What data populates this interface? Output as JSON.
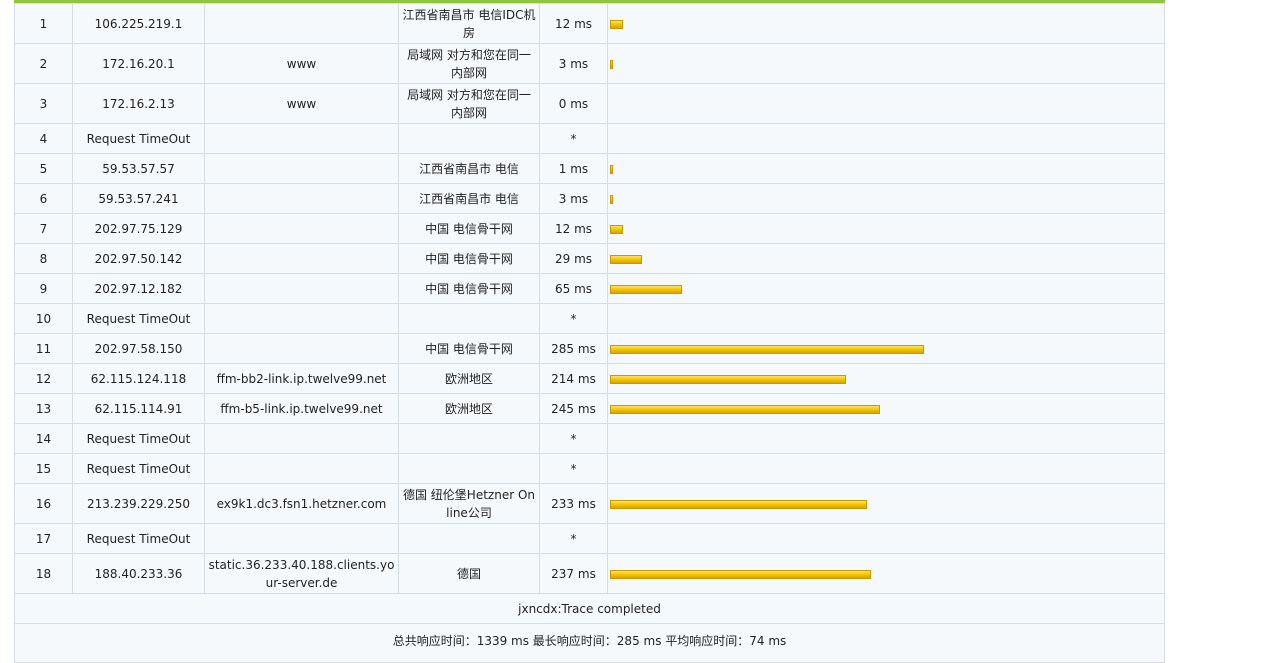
{
  "accent_color": "#8ec63f",
  "bar_color": "#f6c800",
  "max_bar_ms": 285,
  "hops": [
    {
      "hop": "1",
      "ip": "106.225.219.1",
      "host": "",
      "location": "江西省南昌市 电信IDC机房",
      "time": "12 ms",
      "ms": 12
    },
    {
      "hop": "2",
      "ip": "172.16.20.1",
      "host": "www",
      "location": "局域网 对方和您在同一内部网",
      "time": "3 ms",
      "ms": 3
    },
    {
      "hop": "3",
      "ip": "172.16.2.13",
      "host": "www",
      "location": "局域网 对方和您在同一内部网",
      "time": "0 ms",
      "ms": 0
    },
    {
      "hop": "4",
      "ip": "Request TimeOut",
      "host": "",
      "location": "",
      "time": "*",
      "ms": null
    },
    {
      "hop": "5",
      "ip": "59.53.57.57",
      "host": "",
      "location": "江西省南昌市 电信",
      "time": "1 ms",
      "ms": 1
    },
    {
      "hop": "6",
      "ip": "59.53.57.241",
      "host": "",
      "location": "江西省南昌市 电信",
      "time": "3 ms",
      "ms": 3
    },
    {
      "hop": "7",
      "ip": "202.97.75.129",
      "host": "",
      "location": "中国 电信骨干网",
      "time": "12 ms",
      "ms": 12
    },
    {
      "hop": "8",
      "ip": "202.97.50.142",
      "host": "",
      "location": "中国 电信骨干网",
      "time": "29 ms",
      "ms": 29
    },
    {
      "hop": "9",
      "ip": "202.97.12.182",
      "host": "",
      "location": "中国 电信骨干网",
      "time": "65 ms",
      "ms": 65
    },
    {
      "hop": "10",
      "ip": "Request TimeOut",
      "host": "",
      "location": "",
      "time": "*",
      "ms": null
    },
    {
      "hop": "11",
      "ip": "202.97.58.150",
      "host": "",
      "location": "中国 电信骨干网",
      "time": "285 ms",
      "ms": 285
    },
    {
      "hop": "12",
      "ip": "62.115.124.118",
      "host": "ffm-bb2-link.ip.twelve99.net",
      "location": "欧洲地区",
      "time": "214 ms",
      "ms": 214
    },
    {
      "hop": "13",
      "ip": "62.115.114.91",
      "host": "ffm-b5-link.ip.twelve99.net",
      "location": "欧洲地区",
      "time": "245 ms",
      "ms": 245
    },
    {
      "hop": "14",
      "ip": "Request TimeOut",
      "host": "",
      "location": "",
      "time": "*",
      "ms": null
    },
    {
      "hop": "15",
      "ip": "Request TimeOut",
      "host": "",
      "location": "",
      "time": "*",
      "ms": null
    },
    {
      "hop": "16",
      "ip": "213.239.229.250",
      "host": "ex9k1.dc3.fsn1.hetzner.com",
      "location": "德国 纽伦堡Hetzner Online公司",
      "time": "233 ms",
      "ms": 233
    },
    {
      "hop": "17",
      "ip": "Request TimeOut",
      "host": "",
      "location": "",
      "time": "*",
      "ms": null
    },
    {
      "hop": "18",
      "ip": "188.40.233.36",
      "host": "static.36.233.40.188.clients.your-server.de",
      "location": "德国",
      "time": "237 ms",
      "ms": 237
    }
  ],
  "footer": {
    "completed": "jxncdx:Trace completed",
    "summary": "总共响应时间：1339 ms    最长响应时间：285 ms    平均响应时间：74 ms"
  }
}
